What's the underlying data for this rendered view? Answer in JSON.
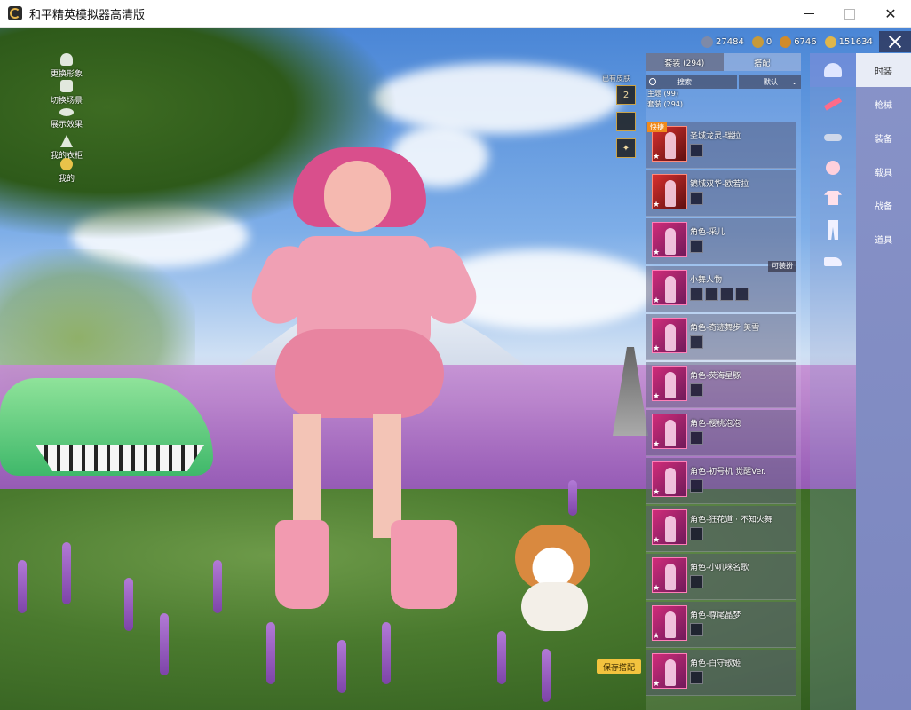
{
  "window": {
    "title": "和平精英模拟器高清版"
  },
  "hud_left": [
    {
      "label": "更换形象",
      "icon": "person-icon"
    },
    {
      "label": "切换场景",
      "icon": "puzzle-icon"
    },
    {
      "label": "展示效果",
      "icon": "eye-icon"
    },
    {
      "label": "我的衣柜",
      "icon": "hanger-icon"
    },
    {
      "label": "我的",
      "icon": "avatar-icon"
    }
  ],
  "currencies": [
    {
      "value": "27484",
      "color": "#7e8aa8"
    },
    {
      "value": "0",
      "color": "#c79a3a"
    },
    {
      "value": "6746",
      "color": "#d18b2a"
    },
    {
      "value": "151634",
      "color": "#e0b64a"
    }
  ],
  "scene_tag": "已有皮肤",
  "float_icons": [
    "2",
    "",
    "✦"
  ],
  "panel": {
    "tabs": [
      "套装 (294)",
      "搭配"
    ],
    "search_label": "搜索",
    "sort_label": "默认",
    "section_theme": "主题 (99)",
    "section_suit": "套装 (294)",
    "quick_badge": "快捷",
    "equip_badge": "可装扮",
    "items": [
      {
        "name": "圣城龙灵-瑞拉",
        "parts": 1,
        "red": true
      },
      {
        "name": "镜城双华-欧若拉",
        "parts": 1,
        "red": true
      },
      {
        "name": "角色-采儿",
        "parts": 1,
        "red": false
      },
      {
        "name": "小舞人物",
        "parts": 4,
        "red": false
      },
      {
        "name": "角色-奇迹舞步 美雪",
        "parts": 1,
        "red": false
      },
      {
        "name": "角色-荧海星豚",
        "parts": 1,
        "red": false
      },
      {
        "name": "角色-樱桃泡泡",
        "parts": 1,
        "red": false
      },
      {
        "name": "角色-初号机 觉醒Ver.",
        "parts": 1,
        "red": false
      },
      {
        "name": "角色-狂花道 · 不知火舞",
        "parts": 1,
        "red": false
      },
      {
        "name": "角色-小叽咪名歌",
        "parts": 1,
        "red": false
      },
      {
        "name": "角色-尊尾晶梦",
        "parts": 1,
        "red": false
      },
      {
        "name": "角色-白守歌姬",
        "parts": 1,
        "red": false
      }
    ]
  },
  "icon_column": [
    "cap-icon",
    "gun-icon",
    "goggles-icon",
    "mask-icon",
    "shirt-icon",
    "pants-icon",
    "shoes-icon"
  ],
  "categories": [
    "时装",
    "枪械",
    "装备",
    "载具",
    "战备",
    "道具"
  ],
  "save_button": "保存搭配"
}
